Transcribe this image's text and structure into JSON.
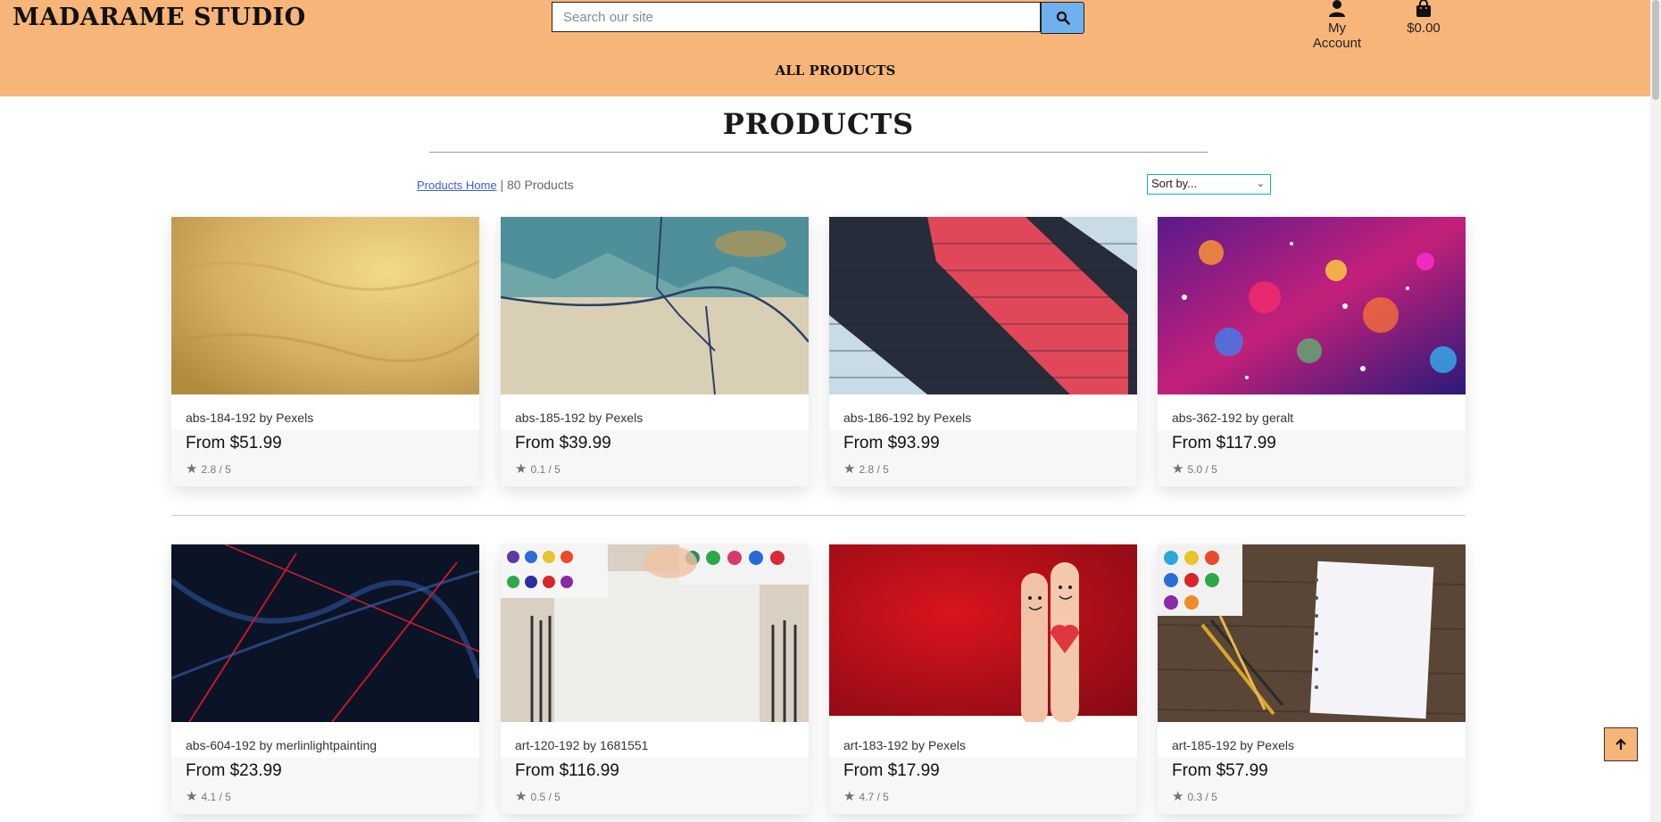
{
  "header": {
    "logo": "MADARAME STUDIO",
    "search_placeholder": "Search our site",
    "account_label": "My Account",
    "cart_total": "$0.00",
    "nav_all_products": "ALL PRODUCTS",
    "colors": {
      "header_bg": "#f7b57a",
      "search_button": "#6fb1ee"
    }
  },
  "main": {
    "title": "PRODUCTS",
    "breadcrumb_link": "Products Home",
    "breadcrumb_sep": " | ",
    "product_count": "80 Products",
    "sort_selected": "Sort by..."
  },
  "products": [
    {
      "title": "abs-184-192 by Pexels",
      "price": "From $51.99",
      "rating": "2.8 / 5"
    },
    {
      "title": "abs-185-192 by Pexels",
      "price": "From $39.99",
      "rating": "0.1 / 5"
    },
    {
      "title": "abs-186-192 by Pexels",
      "price": "From $93.99",
      "rating": "2.8 / 5"
    },
    {
      "title": "abs-362-192 by geralt",
      "price": "From $117.99",
      "rating": "5.0 / 5"
    },
    {
      "title": "abs-604-192 by merlinlightpainting",
      "price": "From $23.99",
      "rating": "4.1 / 5"
    },
    {
      "title": "art-120-192 by 1681551",
      "price": "From $116.99",
      "rating": "0.5 / 5"
    },
    {
      "title": "art-183-192 by Pexels",
      "price": "From $17.99",
      "rating": "4.7 / 5"
    },
    {
      "title": "art-185-192 by Pexels",
      "price": "From $57.99",
      "rating": "0.3 / 5"
    }
  ]
}
